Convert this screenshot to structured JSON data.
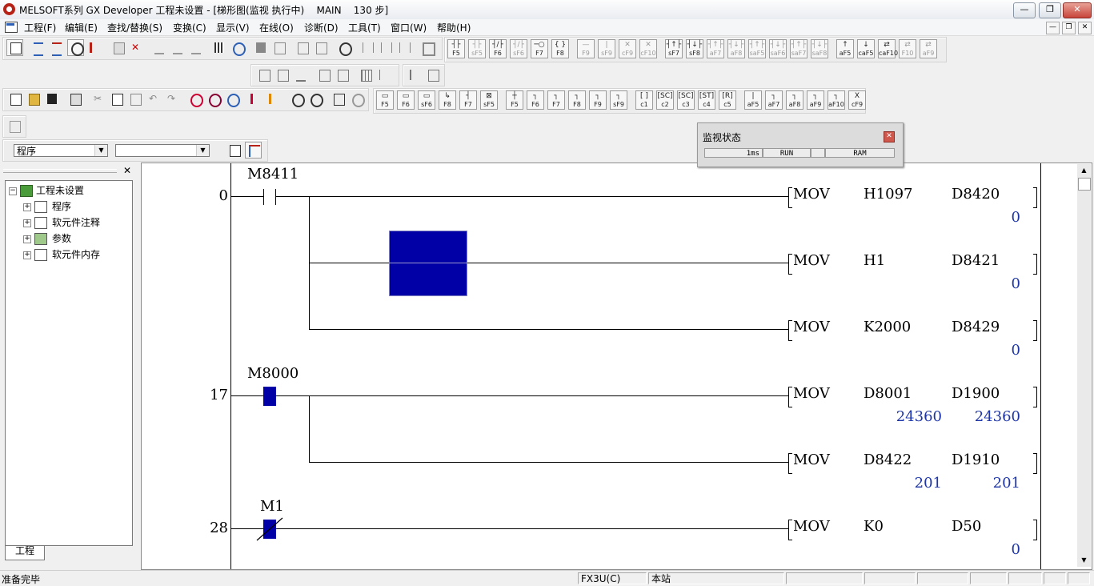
{
  "window": {
    "title": "MELSOFT系列 GX Developer 工程未设置 - [梯形图(监视 执行中)    MAIN    130 步]"
  },
  "menu": [
    "工程(F)",
    "编辑(E)",
    "查找/替换(S)",
    "变换(C)",
    "显示(V)",
    "在线(O)",
    "诊断(D)",
    "工具(T)",
    "窗口(W)",
    "帮助(H)"
  ],
  "fkeys_row1": [
    {
      "sym": "┤├",
      "label": "F5"
    },
    {
      "sym": "┤├",
      "label": "sF5",
      "dim": true
    },
    {
      "sym": "┤/├",
      "label": "F6"
    },
    {
      "sym": "┤/├",
      "label": "sF6",
      "dim": true
    },
    {
      "sym": "─○",
      "label": "F7"
    },
    {
      "sym": "{ }",
      "label": "F8"
    },
    {
      "sym": "—",
      "label": "F9",
      "dim": true
    },
    {
      "sym": "|",
      "label": "sF9",
      "dim": true
    },
    {
      "sym": "✕",
      "label": "cF9",
      "dim": true
    },
    {
      "sym": "✕",
      "label": "cF10",
      "dim": true
    },
    {
      "sym": "┤↑├",
      "label": "sF7"
    },
    {
      "sym": "┤↓├",
      "label": "sF8"
    },
    {
      "sym": "┤↑├",
      "label": "aF7",
      "dim": true
    },
    {
      "sym": "┤↓├",
      "label": "aF8",
      "dim": true
    },
    {
      "sym": "┤↑├",
      "label": "saF5",
      "dim": true
    },
    {
      "sym": "┤↓├",
      "label": "saF6",
      "dim": true
    },
    {
      "sym": "┤↑├",
      "label": "saF7",
      "dim": true
    },
    {
      "sym": "┤↓├",
      "label": "saF8",
      "dim": true
    },
    {
      "sym": "↑",
      "label": "aF5"
    },
    {
      "sym": "↓",
      "label": "caF5"
    },
    {
      "sym": "⇄",
      "label": "caF10"
    },
    {
      "sym": "⇄",
      "label": "F10",
      "dim": true
    },
    {
      "sym": "⇄",
      "label": "aF9",
      "dim": true
    }
  ],
  "fkeys_row3": [
    {
      "sym": "▭",
      "label": "F5"
    },
    {
      "sym": "▭",
      "label": "F6"
    },
    {
      "sym": "▭",
      "label": "sF6"
    },
    {
      "sym": "↳",
      "label": "F8"
    },
    {
      "sym": "┤",
      "label": "F7"
    },
    {
      "sym": "⊠",
      "label": "sF5"
    },
    {
      "sym": "┼",
      "label": "F5"
    },
    {
      "sym": "┐",
      "label": "F6"
    },
    {
      "sym": "┐",
      "label": "F7"
    },
    {
      "sym": "┐",
      "label": "F8"
    },
    {
      "sym": "┐",
      "label": "F9"
    },
    {
      "sym": "┐",
      "label": "sF9"
    },
    {
      "sym": "[ ]",
      "label": "c1"
    },
    {
      "sym": "[SC]",
      "label": "c2"
    },
    {
      "sym": "[SC]",
      "label": "c3"
    },
    {
      "sym": "[ST]",
      "label": "c4"
    },
    {
      "sym": "[R]",
      "label": "c5"
    },
    {
      "sym": "|",
      "label": "aF5"
    },
    {
      "sym": "┐",
      "label": "aF7"
    },
    {
      "sym": "┐",
      "label": "aF8"
    },
    {
      "sym": "┐",
      "label": "aF9"
    },
    {
      "sym": "┐",
      "label": "aF10"
    },
    {
      "sym": "X",
      "label": "cF9"
    }
  ],
  "selectors": {
    "left_value": "程序",
    "right_value": ""
  },
  "tree": {
    "root": "工程未设置",
    "items": [
      "程序",
      "软元件注释",
      "参数",
      "软元件内存"
    ]
  },
  "panel_tab": "工程",
  "monitor": {
    "title": "监视状态",
    "scan": "1ms",
    "mode": "RUN",
    "mem": "RAM"
  },
  "ladder": {
    "contacts": [
      {
        "device": "M8411",
        "step": "0"
      },
      {
        "device": "M8000",
        "step": "17"
      },
      {
        "device": "M1",
        "step": "28"
      }
    ],
    "instructions": [
      {
        "op": "MOV",
        "src": "H1097",
        "dst": "D8420",
        "src_val": "",
        "dst_val": "0"
      },
      {
        "op": "MOV",
        "src": "H1",
        "dst": "D8421",
        "src_val": "",
        "dst_val": "0"
      },
      {
        "op": "MOV",
        "src": "K2000",
        "dst": "D8429",
        "src_val": "",
        "dst_val": "0"
      },
      {
        "op": "MOV",
        "src": "D8001",
        "dst": "D1900",
        "src_val": "24360",
        "dst_val": "24360"
      },
      {
        "op": "MOV",
        "src": "D8422",
        "dst": "D1910",
        "src_val": "201",
        "dst_val": "201"
      },
      {
        "op": "MOV",
        "src": "K0",
        "dst": "D50",
        "src_val": "",
        "dst_val": "0"
      }
    ]
  },
  "statusbar": {
    "ready": "准备完毕",
    "plc": "FX3U(C)",
    "station": "本站"
  },
  "colors": {
    "monitor_on": "#0000a6",
    "value_text": "#1d35a6"
  }
}
